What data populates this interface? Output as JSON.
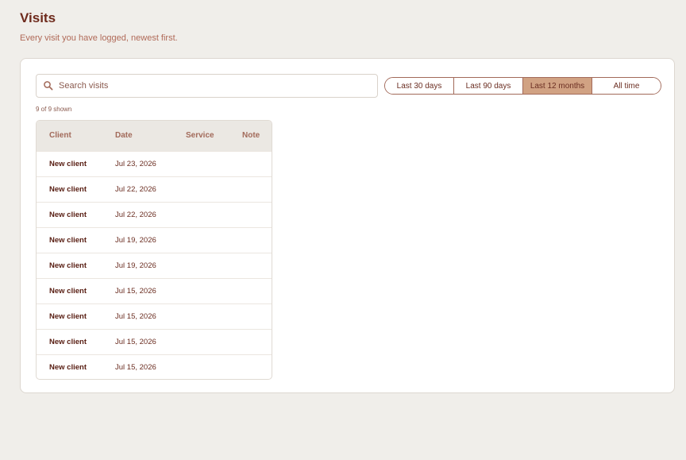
{
  "page": {
    "title": "Visits",
    "subtitle": "Every visit you have logged, newest first."
  },
  "search": {
    "placeholder": "Search visits",
    "value": "",
    "icon": "search-icon"
  },
  "range_filter": {
    "options": [
      "Last 30 days",
      "Last 90 days",
      "Last 12 months",
      "All time"
    ],
    "selected": "Last 12 months"
  },
  "count_label": "9 of 9 shown",
  "table": {
    "columns": [
      "Client",
      "Date",
      "Service",
      "Note"
    ],
    "rows": [
      {
        "client": "New client",
        "date": "Jul 23, 2026",
        "service": "",
        "note": ""
      },
      {
        "client": "New client",
        "date": "Jul 22, 2026",
        "service": "",
        "note": ""
      },
      {
        "client": "New client",
        "date": "Jul 22, 2026",
        "service": "",
        "note": ""
      },
      {
        "client": "New client",
        "date": "Jul 19, 2026",
        "service": "",
        "note": ""
      },
      {
        "client": "New client",
        "date": "Jul 19, 2026",
        "service": "",
        "note": ""
      },
      {
        "client": "New client",
        "date": "Jul 15, 2026",
        "service": "",
        "note": ""
      },
      {
        "client": "New client",
        "date": "Jul 15, 2026",
        "service": "",
        "note": ""
      },
      {
        "client": "New client",
        "date": "Jul 15, 2026",
        "service": "",
        "note": ""
      },
      {
        "client": "New client",
        "date": "Jul 15, 2026",
        "service": "",
        "note": ""
      }
    ]
  },
  "colors": {
    "background": "#f0eeea",
    "accent": "#d1a283",
    "text": "#6b2e22",
    "header_bg": "#ebe8e3"
  }
}
